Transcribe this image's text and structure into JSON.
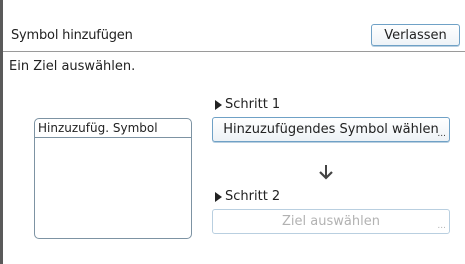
{
  "header": {
    "title": "Symbol hinzufügen",
    "exit_label": "Verlassen"
  },
  "instruction": "Ein Ziel auswählen.",
  "step1": {
    "label": "Schritt 1",
    "button_label": "Hinzuzufügendes Symbol wählen",
    "ellipsis": "..."
  },
  "step2": {
    "label": "Schritt 2",
    "button_label": "Ziel auswählen",
    "ellipsis": "..."
  },
  "panel": {
    "title": "Hinzuzufüg. Symbol"
  },
  "colors": {
    "button_border": "#6fa1c6",
    "disabled_text": "#b2b2b2",
    "panel_border": "#7d93a3"
  },
  "icons": {
    "step_marker": "triangle-right-icon",
    "flow_arrow": "arrow-down-icon"
  }
}
